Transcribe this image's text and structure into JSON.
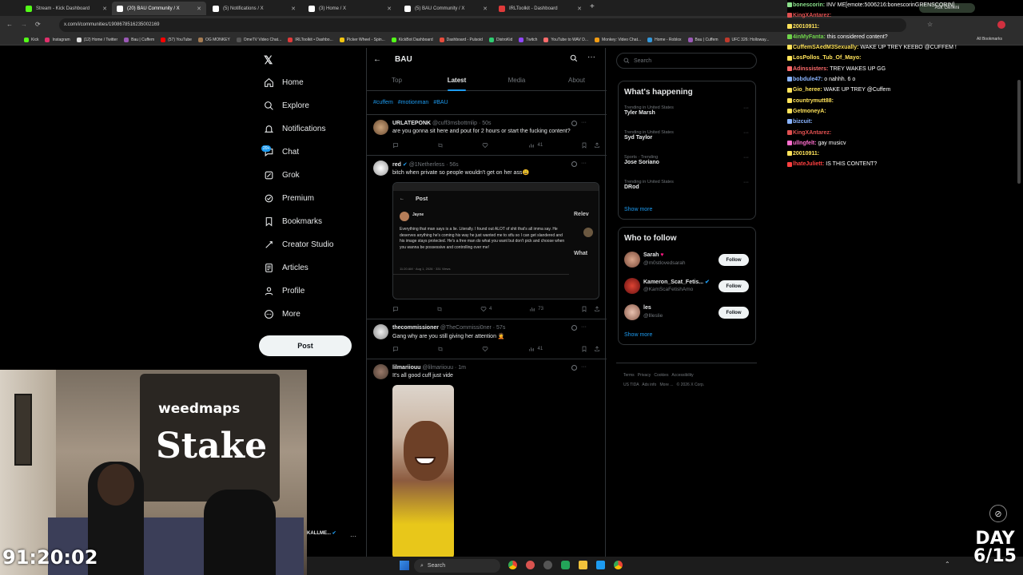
{
  "browser": {
    "tabs": [
      {
        "label": "Stream - Kick Dashboard",
        "color": "#53fc18",
        "active": false
      },
      {
        "label": "(20) BAU Community / X",
        "color": "#ffffff",
        "active": true
      },
      {
        "label": "(5) Notifications / X",
        "color": "#ffffff",
        "active": false
      },
      {
        "label": "(3) Home / X",
        "color": "#ffffff",
        "active": false
      },
      {
        "label": "(5) BAU Community / X",
        "color": "#ffffff",
        "active": false
      },
      {
        "label": "IRLToolkit - Dashboard",
        "color": "#e03a3a",
        "active": false
      }
    ],
    "url": "x.com/i/communities/1908678516235002169",
    "ask_gemini": "Ask Gemini",
    "bookmarks": [
      "Kick",
      "Instagram",
      "(12) Home / Twitter",
      "Bau | Cuffem",
      "(57) YouTube",
      "OG MONKEY",
      "OmeTV Video Chat...",
      "IRLToolkit • Dashbo...",
      "Picker Wheel - Spin...",
      "KickBot Dashboard",
      "Dashboard - Pulsoid",
      "DistroKid",
      "Twitch",
      "YouTube to WAV D...",
      "Monkey: Video Chat...",
      "Home - Roblox",
      "Bau | Cuffem",
      "UFC 326: Holloway..."
    ],
    "all_bookmarks": "All Bookmarks"
  },
  "x_nav": {
    "items": [
      {
        "label": "Home",
        "icon": "home-icon"
      },
      {
        "label": "Explore",
        "icon": "search-icon"
      },
      {
        "label": "Notifications",
        "icon": "bell-icon"
      },
      {
        "label": "Chat",
        "icon": "chat-icon"
      },
      {
        "label": "Grok",
        "icon": "grok-icon"
      },
      {
        "label": "Premium",
        "icon": "premium-icon"
      },
      {
        "label": "Bookmarks",
        "icon": "bookmark-icon"
      },
      {
        "label": "Creator Studio",
        "icon": "creator-icon"
      },
      {
        "label": "Articles",
        "icon": "article-icon"
      },
      {
        "label": "Profile",
        "icon": "profile-icon"
      },
      {
        "label": "More",
        "icon": "more-icon"
      }
    ],
    "chat_badge": "20+",
    "post_label": "Post",
    "account_label": "KALLME..."
  },
  "feed": {
    "title": "BAU",
    "tabs": [
      "Top",
      "Latest",
      "Media",
      "About"
    ],
    "active_tab": "Latest",
    "hashtags": [
      "#cuffem",
      "#motionman",
      "#BAU"
    ],
    "tweets": [
      {
        "name": "URLATEPONK",
        "handle": "@cuff3msbottmlip · 50s",
        "text": "are you gonna sit here and pout for 2 hours or start the fucking content?",
        "likes": "",
        "views": "41"
      },
      {
        "name": "red",
        "handle": "@1Netherless · 56s",
        "text": "bitch when private so people wouldn't get on her ass😩",
        "likes": "4",
        "views": "73"
      },
      {
        "name": "thecommissioner",
        "handle": "@TheCommissi0ner · 57s",
        "text": "Gang why are you still giving her attention 🤦",
        "likes": "",
        "views": "41"
      },
      {
        "name": "lilmariiouu",
        "handle": "@lilmariiouu · 1m",
        "text": "It's all good cuff just vide",
        "likes": "",
        "views": ""
      }
    ],
    "embedded": {
      "header": "Post",
      "author": "Jayne",
      "body": "Everything that man says is a lie. Literally. I found out ALOT of shit that's all imma say. He deserves anything he's coming his way he just wanted me to stfu so I can get slandered and his image stays protected. He's a free man do what you want but don't pick and choose when you wanna be possessive and controlling over me!",
      "meta": "11:20 AM · Aug 1, 2026 · 331 Views"
    }
  },
  "right": {
    "search_placeholder": "Search",
    "happening_title": "What's happening",
    "trends": [
      {
        "category": "Trending in United States",
        "name": "Tyler Marsh"
      },
      {
        "category": "Trending in United States",
        "name": "Syd Taylor"
      },
      {
        "category": "Sports · Trending",
        "name": "Jose Soriano"
      },
      {
        "category": "Trending in United States",
        "name": "DRod"
      }
    ],
    "show_more": "Show more",
    "follow_title": "Who to follow",
    "follows": [
      {
        "name": "Sarah",
        "handle": "@m0stlovedsarah"
      },
      {
        "name": "Kameron_Scat_Fetis...",
        "handle": "@KamScaFetishAmo"
      },
      {
        "name": "les",
        "handle": "@llleslie"
      }
    ],
    "follow_label": "Follow",
    "footer": [
      "Terms",
      "Privacy",
      "Cookies",
      "Accessibility",
      "US TIDA",
      "Ads info",
      "More ...",
      "© 2026 X Corp."
    ]
  },
  "chat": {
    "messages": [
      {
        "user": "bonescorin:",
        "color": "#8be08b",
        "text": "INV ME[emote:5006216:bonescorinGRENSCORIN]"
      },
      {
        "user": "KingXAntarez:",
        "color": "#e05050",
        "text": ""
      },
      {
        "user": "20010911:",
        "color": "#ffe35a",
        "text": ""
      },
      {
        "user": "4inMyFanta:",
        "color": "#6fd34a",
        "text": "this considered content?"
      },
      {
        "user": "CuffemSAedM3Sexually:",
        "color": "#ffe35a",
        "text": "WAKE UP TREY KEEBO @CUFFEM !"
      },
      {
        "user": "LosPollos_Tub_Of_Mayo:",
        "color": "#ffe35a",
        "text": ""
      },
      {
        "user": "Adinssisters:",
        "color": "#ff6b6b",
        "text": "TREY WAKES UP GG"
      },
      {
        "user": "bobdule47:",
        "color": "#8ab4ff",
        "text": "o nahhh. 6 o"
      },
      {
        "user": "Gio_heree:",
        "color": "#ffe35a",
        "text": "WAKE UP TREY @Cuffem"
      },
      {
        "user": "countrymutt88:",
        "color": "#ffe35a",
        "text": ""
      },
      {
        "user": "GetmoneyA:",
        "color": "#ffe35a",
        "text": ""
      },
      {
        "user": "bizcuit:",
        "color": "#8ab4ff",
        "text": ""
      },
      {
        "user": "KingXAntarez:",
        "color": "#e05050",
        "text": ""
      },
      {
        "user": "ullngfelt:",
        "color": "#ff6fcf",
        "text": "gay musicv"
      },
      {
        "user": "20010911:",
        "color": "#ffe35a",
        "text": ""
      },
      {
        "user": "lhateJuliett:",
        "color": "#ff4040",
        "text": "IS THIS CONTENT?"
      }
    ]
  },
  "overlay": {
    "timer": "91:20:02",
    "day_label": "DAY",
    "day_value": "6/15",
    "weedmaps": "weedmaps",
    "stake": "Stake"
  },
  "taskbar": {
    "search": "Search"
  }
}
